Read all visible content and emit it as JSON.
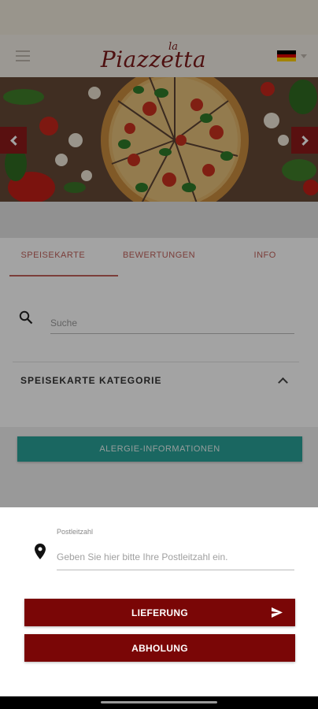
{
  "header": {
    "logo_small": "la",
    "logo_main": "Piazzetta",
    "language_flag": "german-flag-icon",
    "flag_colors": [
      "#000000",
      "#dd0000",
      "#ffce00"
    ]
  },
  "hero": {
    "prev_icon": "chevron-left-icon",
    "next_icon": "chevron-right-icon"
  },
  "tabs": [
    {
      "label": "SPEISEKARTE",
      "active": true
    },
    {
      "label": "BEWERTUNGEN",
      "active": false
    },
    {
      "label": "INFO",
      "active": false
    }
  ],
  "search": {
    "placeholder": "Suche",
    "icon": "search-icon"
  },
  "menu_category": {
    "title": "SPEISEKARTE KATEGORIE",
    "icon": "chevron-up-icon"
  },
  "allergy_button": {
    "label": "ALERGIE-INFORMATIONEN"
  },
  "postal_sheet": {
    "label": "Postleitzahl",
    "placeholder": "Geben Sie hier bitte Ihre Postleitzahl ein.",
    "icon": "location-pin-icon"
  },
  "actions": {
    "delivery_label": "LIEFERUNG",
    "delivery_icon": "send-icon",
    "pickup_label": "ABHOLUNG"
  },
  "colors": {
    "brand_red": "#7a0606",
    "teal": "#2aa198",
    "tab_accent": "#c0625c"
  }
}
